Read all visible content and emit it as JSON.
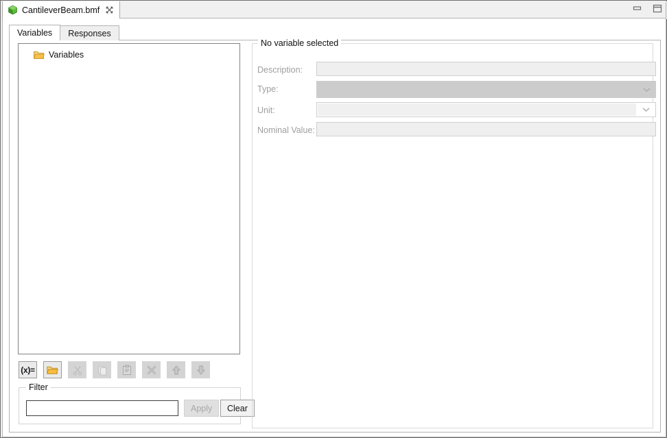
{
  "window": {
    "minimize_label": "Minimize",
    "maximize_label": "Maximize",
    "minimize_icon": "minimize-icon",
    "maximize_icon": "maximize-restore-icon"
  },
  "editor_tab": {
    "title": "CantileverBeam.bmf",
    "icon": "green-cube-icon",
    "close_icon": "close-icon",
    "close_label": "✖"
  },
  "tabs": [
    {
      "label": "Variables",
      "active": true
    },
    {
      "label": "Responses",
      "active": false
    }
  ],
  "tree": {
    "items": [
      {
        "label": "Variables",
        "icon": "folder-icon"
      }
    ]
  },
  "toolbar": {
    "buttons": [
      {
        "name": "new-variable-button",
        "label": "(x)=",
        "icon": "variable-icon",
        "enabled": true,
        "style": "enabled"
      },
      {
        "name": "new-folder-button",
        "label": "",
        "icon": "folder-icon",
        "enabled": true,
        "style": "enabled"
      },
      {
        "name": "cut-button",
        "label": "",
        "icon": "scissors-icon",
        "enabled": false,
        "style": "flat"
      },
      {
        "name": "copy-button",
        "label": "",
        "icon": "copy-icon",
        "enabled": false,
        "style": "flat"
      },
      {
        "name": "paste-button",
        "label": "",
        "icon": "paste-icon",
        "enabled": true,
        "style": "flat"
      },
      {
        "name": "delete-button",
        "label": "",
        "icon": "delete-x-icon",
        "enabled": false,
        "style": "flat"
      },
      {
        "name": "move-up-button",
        "label": "",
        "icon": "arrow-up-icon",
        "enabled": true,
        "style": "flat"
      },
      {
        "name": "move-down-button",
        "label": "",
        "icon": "arrow-down-icon",
        "enabled": true,
        "style": "flat"
      }
    ]
  },
  "filter": {
    "legend": "Filter",
    "input_value": "",
    "input_placeholder": "",
    "apply_label": "Apply",
    "apply_enabled": false,
    "clear_label": "Clear",
    "clear_enabled": true
  },
  "details": {
    "legend": "No variable selected",
    "fields": [
      {
        "label": "Description:",
        "value": "",
        "control": "text",
        "enabled": false
      },
      {
        "label": "Type:",
        "value": "",
        "control": "combo",
        "enabled": false
      },
      {
        "label": "Unit:",
        "value": "",
        "control": "combo",
        "enabled": false
      },
      {
        "label": "Nominal Value:",
        "value": "",
        "control": "text",
        "enabled": false
      }
    ]
  },
  "colors": {
    "accent_green": "#49a430",
    "folder_yellow": "#f2b950",
    "window_bg": "#f0f0f0",
    "disabled_text": "#9e9e9e",
    "combo_dark": "#cccccc",
    "field_disabled": "#efefef"
  }
}
